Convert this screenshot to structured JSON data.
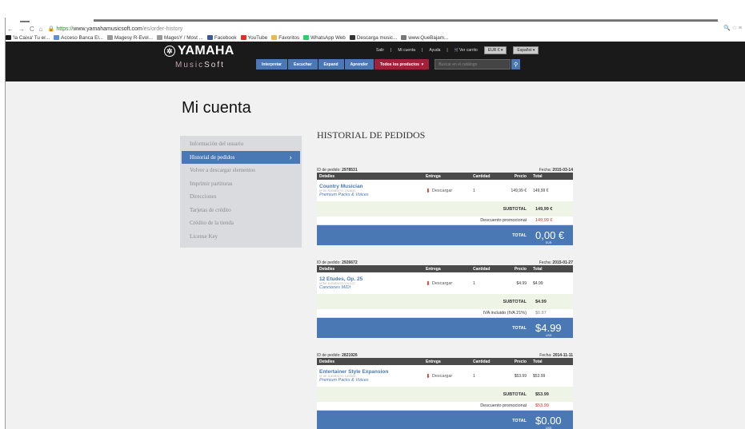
{
  "browser": {
    "url_https": "https://",
    "url_host": "www.yamahamusicsoft.com",
    "url_path": "/es/order-history",
    "bookmarks": [
      {
        "label": "'la Caixa' Tu er...",
        "icon": "caixa-icon",
        "color": "#1a1a1a"
      },
      {
        "label": "Acceso Banca El...",
        "icon": "bank-icon",
        "color": "#5b8fd6"
      },
      {
        "label": "Magesy R-Evol...",
        "icon": "magesy-icon",
        "color": "#999"
      },
      {
        "label": "MagesY / Most ...",
        "icon": "magesy-icon",
        "color": "#999"
      },
      {
        "label": "Facebook",
        "icon": "facebook-icon",
        "color": "#3b5998"
      },
      {
        "label": "YouTube",
        "icon": "youtube-icon",
        "color": "#e52d27"
      },
      {
        "label": "Favoritos",
        "icon": "folder-icon",
        "color": "#e8b84a"
      },
      {
        "label": "WhatsApp Web",
        "icon": "whatsapp-icon",
        "color": "#25d366"
      },
      {
        "label": "Descarga music...",
        "icon": "download-icon",
        "color": "#333"
      },
      {
        "label": "www.QueBajam...",
        "icon": "link-icon",
        "color": "#777"
      }
    ]
  },
  "header": {
    "brand": "YAMAHA",
    "sub_a": "Music",
    "sub_b": "Soft",
    "links": [
      "Salir",
      "Mi cuenta",
      "Ayuda",
      "Ver carrito"
    ],
    "currency": "EUR €",
    "language": "Español",
    "nav": [
      "Interpretar",
      "Escuchar",
      "Expand",
      "Aprender"
    ],
    "nav_all": "Todos los productos",
    "search_placeholder": "Buscar en el catálogo"
  },
  "page": {
    "title": "Mi cuenta",
    "history_title": "HISTORIAL DE PEDIDOS"
  },
  "sidebar": [
    {
      "label": "Información del usuario"
    },
    {
      "label": "Historial de pedidos"
    },
    {
      "label": "Volver a descargar elementos"
    },
    {
      "label": "Imprimir partituras"
    },
    {
      "label": "Direcciones"
    },
    {
      "label": "Tarjetas de crédito"
    },
    {
      "label": "Crédito de la tienda"
    },
    {
      "label": "License Key"
    }
  ],
  "table_headers": [
    "Detalles",
    "Entrega",
    "Cantidad",
    "Precio",
    "Total"
  ],
  "orders": [
    {
      "id_label": "ID de pedido:",
      "id": "2978531",
      "date_label": "Fecha:",
      "date": "2015-03-14",
      "product": "Country Musician",
      "element_id": "Nº DE ELEMENTO: 1318620",
      "category": "Premium Packs & Voices",
      "delivery": "Descargar",
      "qty": "1",
      "price": "149,99 €",
      "total": "149,99 €",
      "subtotal_label": "SUBTOTAL",
      "subtotal": "149,99 €",
      "extra_label": "Descuento promocional",
      "extra": "149,99 €",
      "extra_color": "#d0342c",
      "total_label": "TOTAL",
      "grand_total": "0,00 €",
      "currency": "EUR"
    },
    {
      "id_label": "ID de pedido:",
      "id": "2926672",
      "date_label": "Fecha:",
      "date": "2015-01-27",
      "product": "12 Etudes, Op. 25",
      "element_id": "Nº DE ELEMENTO: 1011127",
      "category": "Canciones MIDI",
      "delivery": "Descargar",
      "qty": "1",
      "price": "$4.99",
      "total": "$4.99",
      "subtotal_label": "SUBTOTAL",
      "subtotal": "$4.99",
      "extra_label": "IVA incluido (IVA 21%)",
      "extra": "$0.87",
      "extra_color": "#888888",
      "total_label": "TOTAL",
      "grand_total": "$4.99",
      "currency": "USD"
    },
    {
      "id_label": "ID de pedido:",
      "id": "2821926",
      "date_label": "Fecha:",
      "date": "2014-11-11",
      "product": "Entertainer Style Expansion",
      "element_id": "Nº DE ELEMENTO: 1203393",
      "category": "Premium Packs & Voices",
      "delivery": "Descargar",
      "qty": "1",
      "price": "$53.99",
      "total": "$53.99",
      "subtotal_label": "SUBTOTAL",
      "subtotal": "$53.99",
      "extra_label": "Descuento promocional",
      "extra": "$53.99",
      "extra_color": "#d0342c",
      "total_label": "TOTAL",
      "grand_total": "$0.00",
      "currency": "USD"
    }
  ]
}
